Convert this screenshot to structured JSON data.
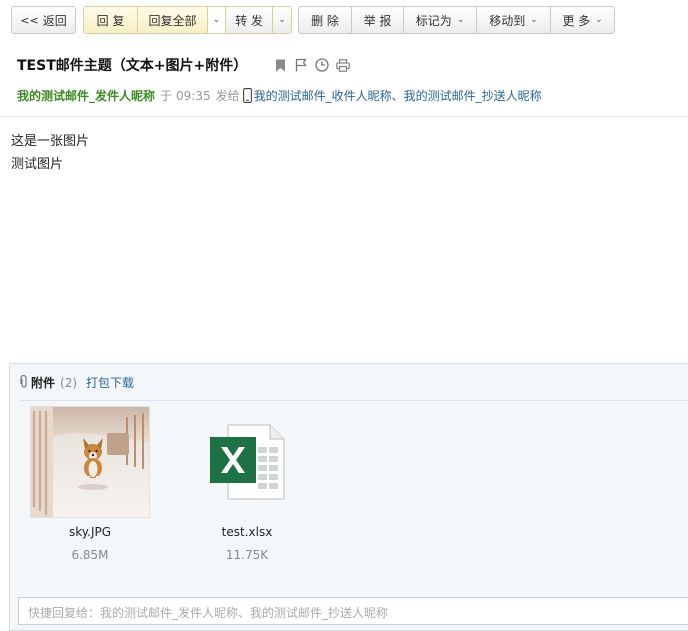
{
  "toolbar": {
    "back_label": "返回",
    "reply_label": "回 复",
    "reply_all_label": "回复全部",
    "forward_label": "转 发",
    "delete_label": "删 除",
    "report_label": "举 报",
    "mark_as_label": "标记为",
    "move_to_label": "移动到",
    "more_label": "更 多"
  },
  "email": {
    "subject": "TEST邮件主题（文本+图片+附件）",
    "sender": "我的测试邮件_发件人昵称",
    "time_prefix": "于",
    "time": "09:35",
    "sent_word": "发给",
    "recipients": "我的测试邮件_收件人昵称、我的测试邮件_抄送人昵称",
    "body_lines": [
      "这是一张图片",
      "测试图片"
    ]
  },
  "attachments": {
    "title": "附件",
    "count": "(2)",
    "download_all": "打包下载",
    "files": [
      {
        "name": "sky.JPG",
        "size": "6.85M",
        "type": "image"
      },
      {
        "name": "test.xlsx",
        "size": "11.75K",
        "type": "excel"
      }
    ]
  },
  "quick_reply": {
    "placeholder": "快捷回复给：我的测试邮件_发件人昵称、我的测试邮件_抄送人昵称"
  },
  "colors": {
    "sender": "#3d8b26",
    "link": "#2a6496",
    "excel_green": "#1e7145",
    "reply_bg": "#fffce8"
  }
}
